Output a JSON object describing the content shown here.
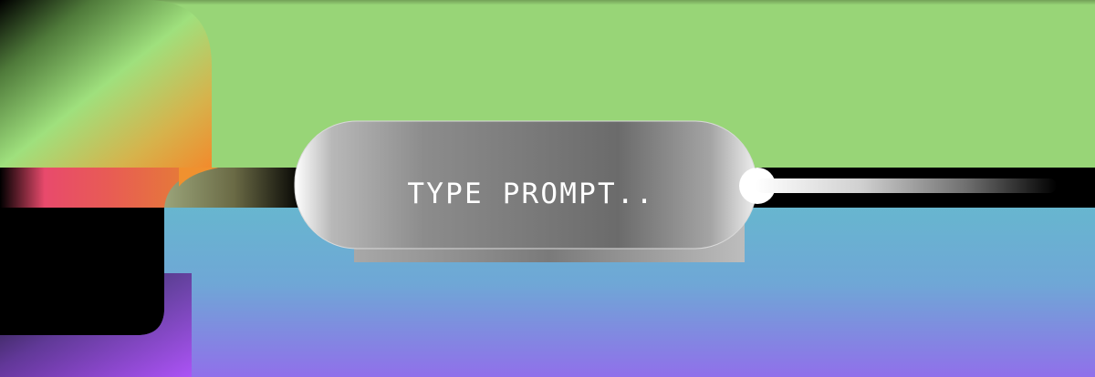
{
  "prompt": {
    "placeholder": "TYPE PROMPT.."
  },
  "colors": {
    "top_green": "#98d577",
    "bottom_top": "#6cb0d2",
    "bottom_bottom": "#8f70ec",
    "pill_light": "#f5f5f5",
    "pill_dark": "#6b6b6b",
    "accent_pink": "#e44c6a",
    "accent_orange": "#f0912f",
    "accent_teal": "#60c0c9",
    "accent_purple": "#b14ef8"
  }
}
